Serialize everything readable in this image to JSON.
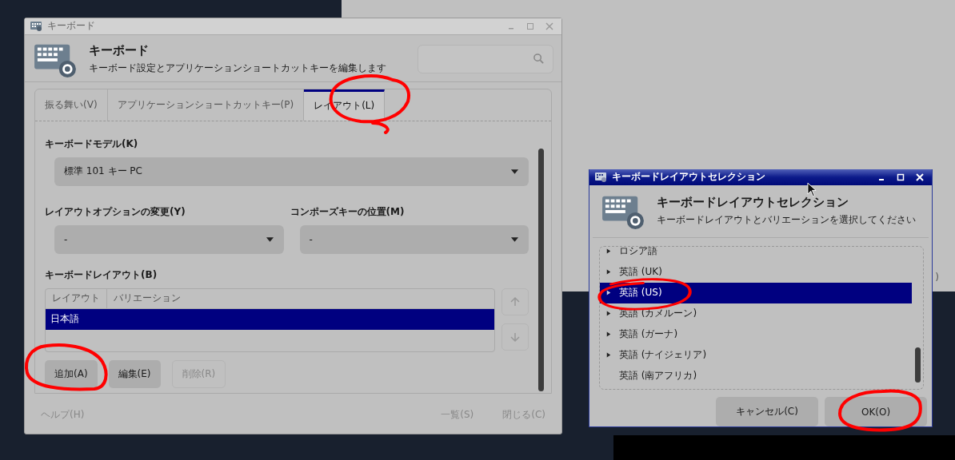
{
  "background_window": {
    "text": ")"
  },
  "main_window": {
    "title": "キーボード",
    "header": {
      "title": "キーボード",
      "subtitle": "キーボード設定とアプリケーションショートカットキーを編集します"
    },
    "tabs": [
      {
        "label": "振る舞い(V)",
        "selected": false
      },
      {
        "label": "アプリケーションショートカットキー(P)",
        "selected": false
      },
      {
        "label": "レイアウト(L)",
        "selected": true
      }
    ],
    "keyboard_model": {
      "label": "キーボードモデル(K)",
      "value": "標準 101 キー PC"
    },
    "layout_options": {
      "label": "レイアウトオプションの変更(Y)",
      "value": "-"
    },
    "compose_key": {
      "label": "コンポーズキーの位置(M)",
      "value": "-"
    },
    "layouts": {
      "label": "キーボードレイアウト(B)",
      "columns": [
        "レイアウト",
        "バリエーション"
      ],
      "rows": [
        {
          "layout": "日本語",
          "selected": true
        }
      ]
    },
    "layout_buttons": [
      {
        "label": "追加(A)",
        "disabled": false
      },
      {
        "label": "編集(E)",
        "disabled": false
      },
      {
        "label": "削除(R)",
        "disabled": true
      }
    ],
    "footer_buttons": [
      {
        "label": "ヘルプ(H)",
        "disabled": true
      },
      {
        "label": "一覧(S)",
        "disabled": true
      },
      {
        "label": "閉じる(C)",
        "disabled": true
      }
    ]
  },
  "dialog": {
    "title": "キーボードレイアウトセレクション",
    "header": {
      "title": "キーボードレイアウトセレクション",
      "subtitle": "キーボードレイアウトとバリエーションを選択してください"
    },
    "items": [
      {
        "label": "ロシア語",
        "expandable": true,
        "selected": false
      },
      {
        "label": "英語 (UK)",
        "expandable": true,
        "selected": false
      },
      {
        "label": "英語 (US)",
        "expandable": true,
        "selected": true
      },
      {
        "label": "英語 (カメルーン)",
        "expandable": true,
        "selected": false
      },
      {
        "label": "英語 (ガーナ)",
        "expandable": true,
        "selected": false
      },
      {
        "label": "英語 (ナイジェリア)",
        "expandable": true,
        "selected": false
      },
      {
        "label": "英語 (南アフリカ)",
        "expandable": false,
        "selected": false
      }
    ],
    "buttons": [
      "キャンセル(C)",
      "OK(O)"
    ]
  }
}
